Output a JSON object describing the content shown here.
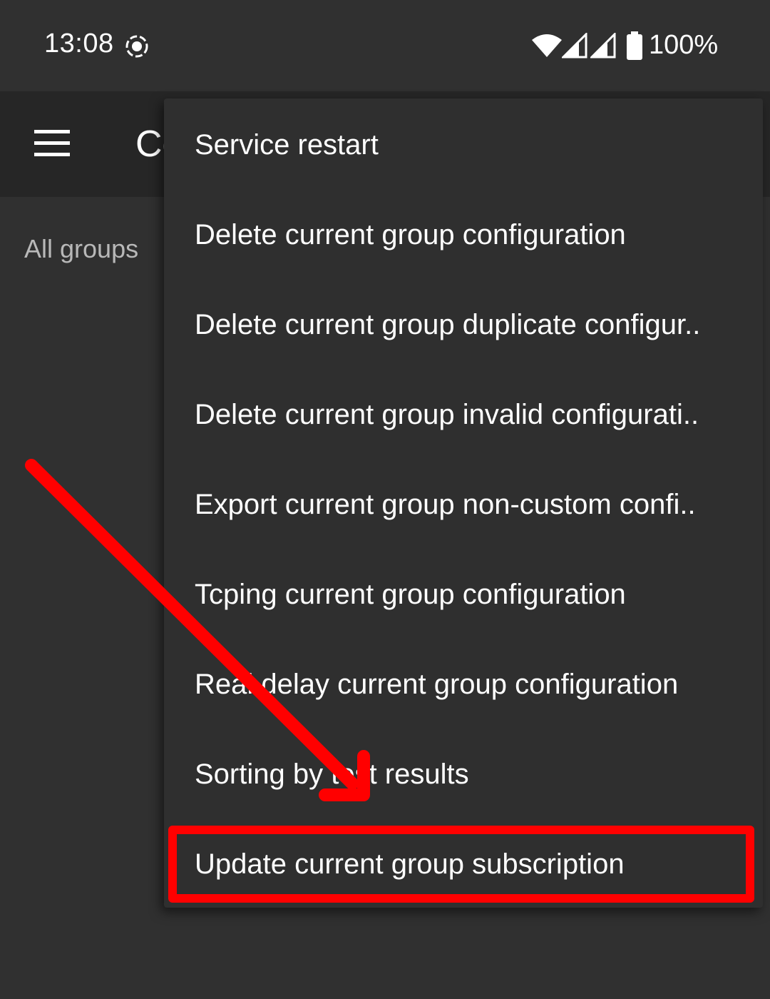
{
  "status_bar": {
    "time": "13:08",
    "battery": "100%"
  },
  "app_bar": {
    "title": "Co"
  },
  "tabs": {
    "label": "All groups"
  },
  "menu": {
    "items": [
      {
        "label": "Service restart"
      },
      {
        "label": "Delete current group configuration"
      },
      {
        "label": "Delete current group duplicate configur.."
      },
      {
        "label": "Delete current group invalid configurati.."
      },
      {
        "label": "Export current group non-custom confi.."
      },
      {
        "label": "Tcping current group configuration"
      },
      {
        "label": "Real delay current group configuration"
      },
      {
        "label": "Sorting by test results"
      },
      {
        "label": "Update current group subscription"
      }
    ]
  },
  "annotation": {
    "color": "#ff0000"
  }
}
